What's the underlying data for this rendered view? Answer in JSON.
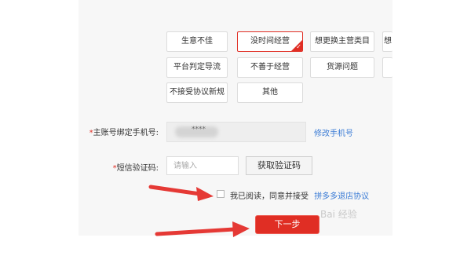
{
  "reasons": {
    "row1": [
      "生意不佳",
      "没时间经营",
      "想更换主营类目",
      "想"
    ],
    "row2": [
      "平台判定导流",
      "不善于经营",
      "货源问题"
    ],
    "row3": [
      "不接受协议新规",
      "其他"
    ]
  },
  "form": {
    "phone": {
      "required_mark": "*",
      "label": "主账号绑定手机号:",
      "masked_value": "****",
      "change_link": "修改手机号"
    },
    "sms": {
      "required_mark": "*",
      "label": "短信验证码:",
      "placeholder": "请输入",
      "get_code_button": "获取验证码"
    },
    "agreement": {
      "checked": false,
      "text": "我已阅读，同意并接受",
      "link": "拼多多退店协议"
    },
    "next_button": "下一步"
  },
  "watermark_text": "Bai 经验",
  "colors": {
    "brand_red": "#e02e24",
    "link_blue": "#3a7bd5",
    "annotation_red": "#e53935"
  }
}
